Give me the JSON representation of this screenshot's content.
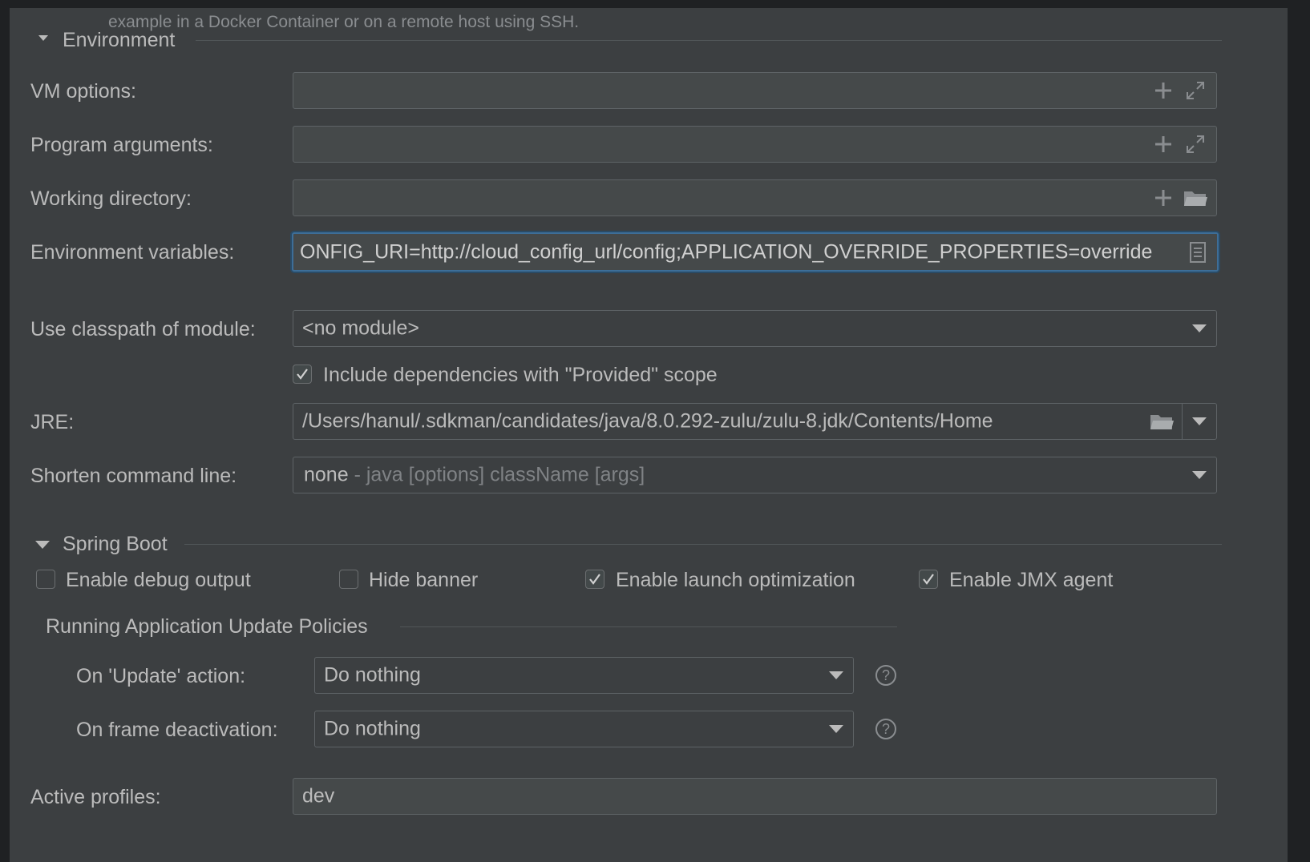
{
  "header_hint": "example in a Docker Container or on a remote host using SSH.",
  "environment": {
    "title": "Environment",
    "vm_options": {
      "label": "VM options:",
      "value": ""
    },
    "program_arguments": {
      "label": "Program arguments:",
      "value": ""
    },
    "working_directory": {
      "label": "Working directory:",
      "value": ""
    },
    "environment_variables": {
      "label": "Environment variables:",
      "value": "ONFIG_URI=http://cloud_config_url/config;APPLICATION_OVERRIDE_PROPERTIES=override"
    },
    "classpath_module": {
      "label": "Use classpath of module:",
      "value": "<no module>"
    },
    "include_provided": {
      "label": "Include dependencies with \"Provided\" scope",
      "checked": true
    },
    "jre": {
      "label": "JRE:",
      "value": "/Users/hanul/.sdkman/candidates/java/8.0.292-zulu/zulu-8.jdk/Contents/Home"
    },
    "shorten_command_line": {
      "label": "Shorten command line:",
      "value": "none",
      "hint": "- java [options] className [args]"
    }
  },
  "spring_boot": {
    "title": "Spring Boot",
    "enable_debug_output": {
      "label": "Enable debug output",
      "checked": false
    },
    "hide_banner": {
      "label": "Hide banner",
      "checked": false
    },
    "enable_launch_optimization": {
      "label": "Enable launch optimization",
      "checked": true
    },
    "enable_jmx_agent": {
      "label": "Enable JMX agent",
      "checked": true
    },
    "update_policies": {
      "title": "Running Application Update Policies",
      "on_update": {
        "label": "On 'Update' action:",
        "value": "Do nothing"
      },
      "on_frame_deactivation": {
        "label": "On frame deactivation:",
        "value": "Do nothing"
      }
    },
    "active_profiles": {
      "label": "Active profiles:",
      "value": "dev"
    }
  },
  "icons": {
    "plus": "plus-icon",
    "expand": "expand-icon",
    "folder": "folder-icon",
    "document": "document-icon",
    "dropdown": "chevron-down-icon",
    "help": "help-icon"
  },
  "colors": {
    "background": "#3c3f41",
    "field": "#45494a",
    "focus_border": "#3d6e98",
    "text": "#bbbbbb",
    "hint_text": "#8a8d90"
  }
}
